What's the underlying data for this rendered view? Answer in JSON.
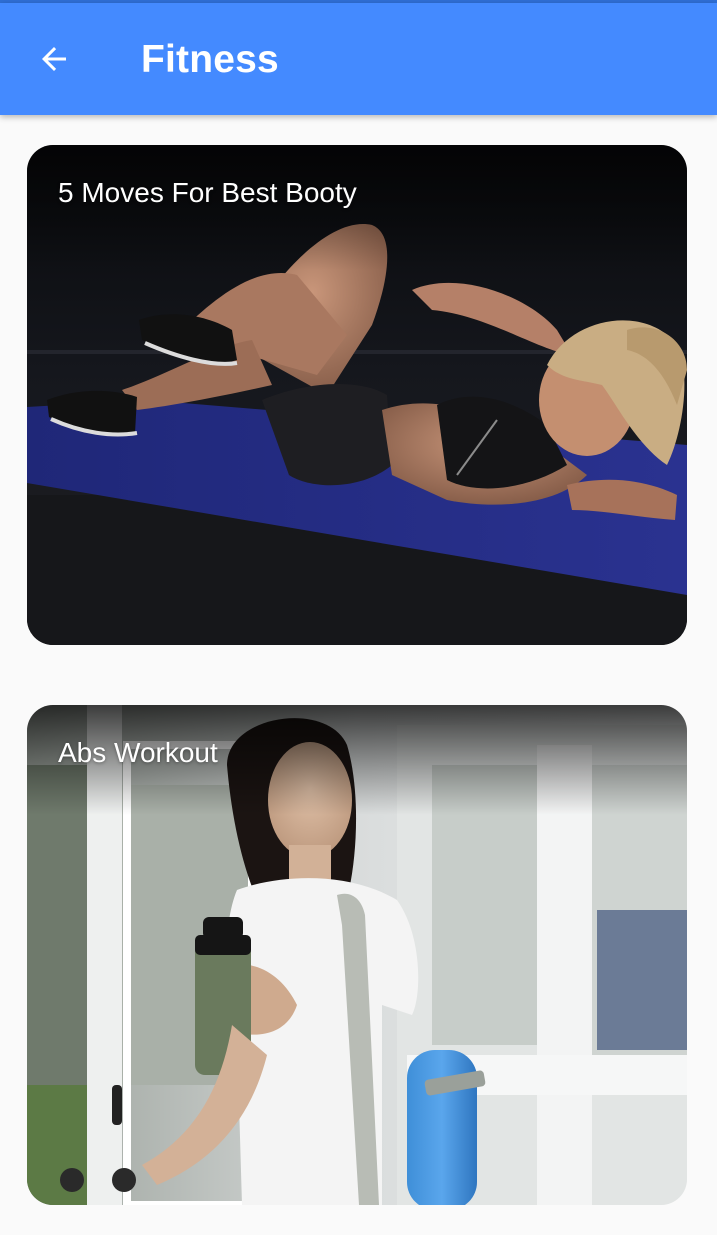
{
  "app_bar": {
    "title": "Fitness",
    "back_icon": "arrow-left-icon",
    "background_color": "#448aff"
  },
  "cards": [
    {
      "title": "5 Moves For Best Booty"
    },
    {
      "title": "Abs Workout"
    }
  ]
}
